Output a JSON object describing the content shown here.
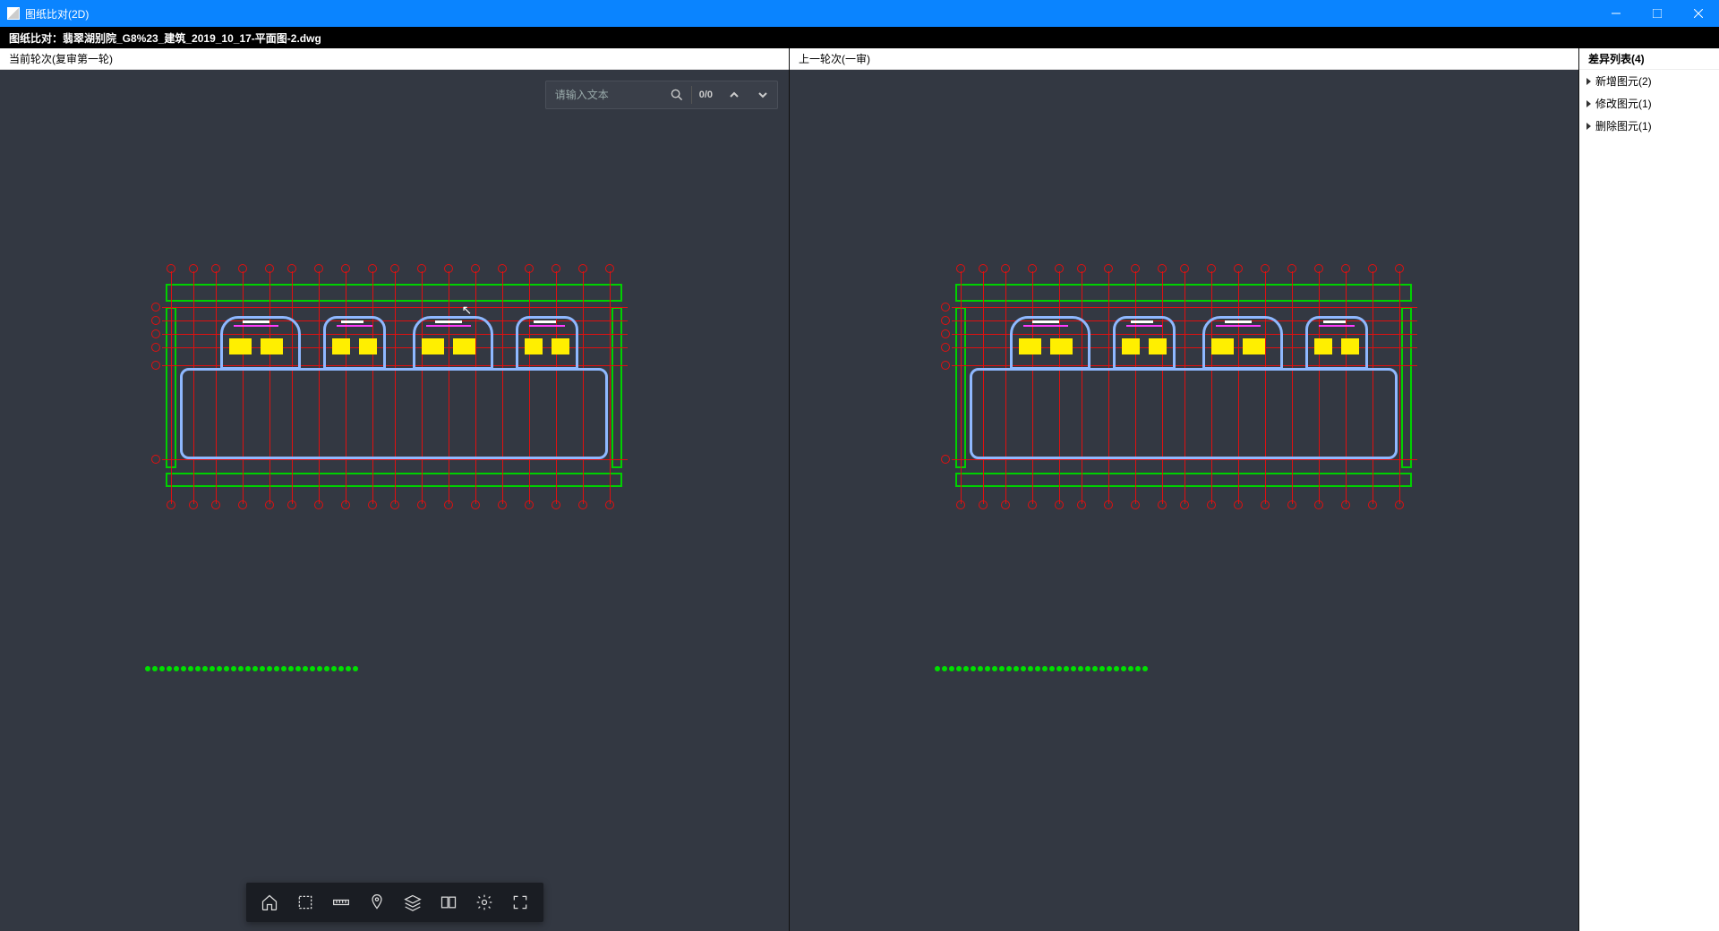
{
  "titlebar": {
    "title": "图纸比对(2D)"
  },
  "header": {
    "title": "图纸比对：翡翠湖别院_G8%23_建筑_2019_10_17-平面图-2.dwg"
  },
  "panes": {
    "left": {
      "title": "当前轮次(复审第一轮)"
    },
    "right": {
      "title": "上一轮次(一审)"
    }
  },
  "search": {
    "placeholder": "请输入文本",
    "count": "0/0"
  },
  "sidebar": {
    "title": "差异列表(4)",
    "items": [
      {
        "label": "新增图元(2)"
      },
      {
        "label": "修改图元(1)"
      },
      {
        "label": "删除图元(1)"
      }
    ]
  },
  "toolbar": {
    "home": "home-icon",
    "region": "region-select-icon",
    "measure": "ruler-icon",
    "pin": "pin-icon",
    "layers": "layers-icon",
    "compare": "compare-icon",
    "settings": "gear-icon",
    "fullscreen": "fullscreen-icon"
  }
}
